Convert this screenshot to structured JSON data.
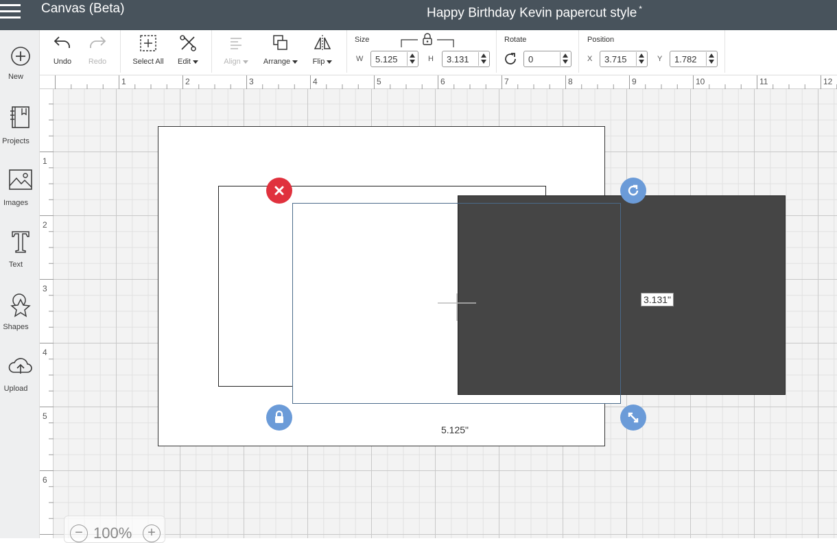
{
  "header": {
    "app_title": "Canvas (Beta)",
    "document_title": "Happy Birthday Kevin papercut style",
    "unsaved_marker": "*"
  },
  "sidebar": {
    "items": [
      {
        "label": "New",
        "icon": "plus-circle-icon"
      },
      {
        "label": "Projects",
        "icon": "book-icon"
      },
      {
        "label": "Images",
        "icon": "image-icon"
      },
      {
        "label": "Text",
        "icon": "text-icon"
      },
      {
        "label": "Shapes",
        "icon": "shapes-icon"
      },
      {
        "label": "Upload",
        "icon": "upload-cloud-icon"
      }
    ]
  },
  "toolbar": {
    "undo_label": "Undo",
    "redo_label": "Redo",
    "select_all_label": "Select All",
    "edit_label": "Edit",
    "align_label": "Align",
    "arrange_label": "Arrange",
    "flip_label": "Flip",
    "size": {
      "label": "Size",
      "w_prefix": "W",
      "w_value": "5.125",
      "h_prefix": "H",
      "h_value": "3.131"
    },
    "rotate": {
      "label": "Rotate",
      "value": "0"
    },
    "position": {
      "label": "Position",
      "x_prefix": "X",
      "x_value": "3.715",
      "y_prefix": "Y",
      "y_value": "1.782"
    }
  },
  "rulers": {
    "top": [
      "1",
      "2",
      "3",
      "4",
      "5",
      "6",
      "7",
      "8",
      "9",
      "10",
      "11",
      "12"
    ],
    "left": [
      "1",
      "2",
      "3",
      "4",
      "5",
      "6"
    ]
  },
  "canvas": {
    "width_label": "5.125\"",
    "height_label": "3.131\"",
    "colors": {
      "dark_layer": "#454545",
      "selection": "#4a6a8a",
      "delete_handle": "#e0313d",
      "handle": "#6b9bd8"
    }
  },
  "zoom": {
    "value": "100%"
  }
}
